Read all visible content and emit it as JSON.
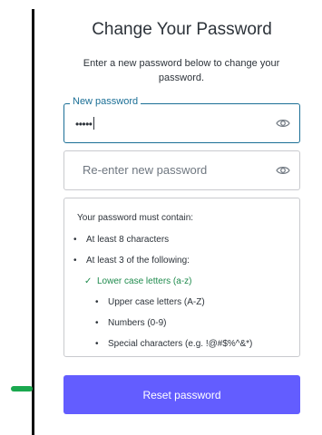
{
  "header": {
    "title": "Change Your Password",
    "subtitle": "Enter a new password below to change your password."
  },
  "new_password": {
    "label": "New password",
    "value": "•••••",
    "icon": "eye-icon"
  },
  "confirm_password": {
    "placeholder": "Re-enter new password",
    "icon": "eye-icon"
  },
  "requirements": {
    "heading": "Your password must contain:",
    "items": [
      {
        "mark": "•",
        "text": "At least 8 characters",
        "met": false
      },
      {
        "mark": "•",
        "text": "At least 3 of the following:",
        "met": false
      },
      {
        "mark": "✓",
        "text": "Lower case letters (a-z)",
        "met": true
      },
      {
        "mark": "•",
        "text": "Upper case letters (A-Z)",
        "met": false
      },
      {
        "mark": "•",
        "text": "Numbers (0-9)",
        "met": false
      },
      {
        "mark": "•",
        "text": "Special characters (e.g. !@#$%^&*)",
        "met": false
      }
    ]
  },
  "actions": {
    "reset_label": "Reset password"
  },
  "colors": {
    "accent": "#635dff",
    "focus": "#1b6f96",
    "met": "#1f8b4d",
    "marker": "#1aa84f"
  }
}
